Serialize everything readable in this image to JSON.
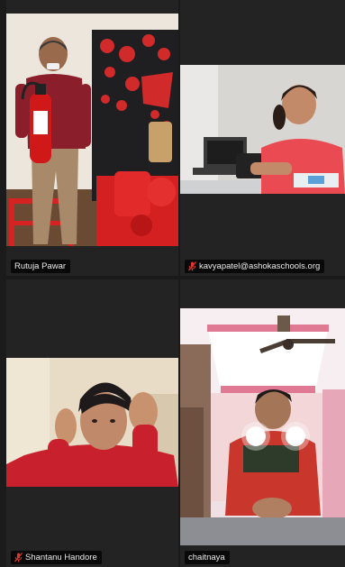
{
  "participants": [
    {
      "name": "Rutuja Pawar",
      "muted": false
    },
    {
      "name": "kavyapatel@ashokaschools.org",
      "muted": true
    },
    {
      "name": "Shantanu Handore",
      "muted": true
    },
    {
      "name": "chaitnaya",
      "muted": false
    }
  ],
  "icons": {
    "muted_indicator": "mic-off-icon"
  },
  "colors": {
    "mic_off": "#e0362c",
    "tile_bg": "#232323",
    "nametag_bg": "#000000b8"
  }
}
